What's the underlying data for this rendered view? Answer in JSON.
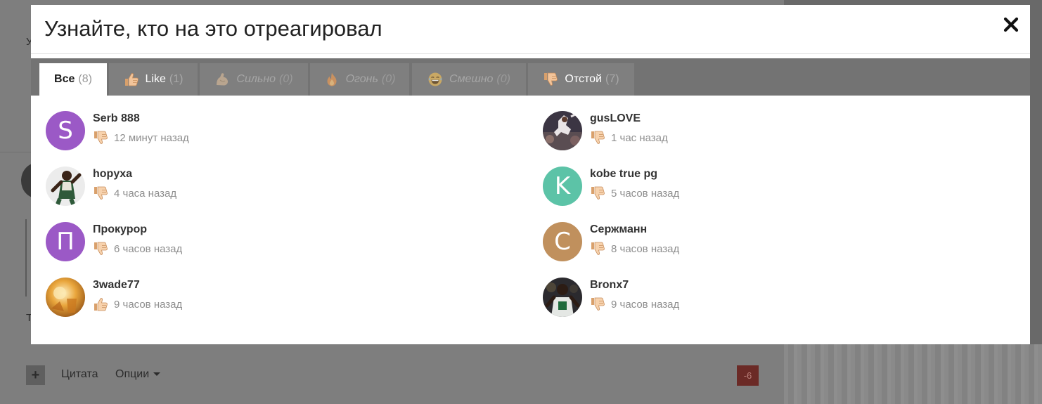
{
  "modal": {
    "title": "Узнайте, кто на это отреагировал"
  },
  "tabs": [
    {
      "label": "Все",
      "count": "(8)"
    },
    {
      "label": "Like",
      "count": "(1)"
    },
    {
      "label": "Сильно",
      "count": "(0)"
    },
    {
      "label": "Огонь",
      "count": "(0)"
    },
    {
      "label": "Смешно",
      "count": "(0)"
    },
    {
      "label": "Отстой",
      "count": "(7)"
    }
  ],
  "users": [
    {
      "name": "Serb 888",
      "time": "12 минут назад",
      "reaction": "thumbs-down-icon",
      "avatar_letter": "S",
      "avatar_color": "#9b59c6"
    },
    {
      "name": "gusLOVE",
      "time": "1 час назад",
      "reaction": "thumbs-down-icon"
    },
    {
      "name": "hopyxa",
      "time": "4 часа назад",
      "reaction": "thumbs-down-icon"
    },
    {
      "name": "kobe true pg",
      "time": "5 часов назад",
      "reaction": "thumbs-down-icon",
      "avatar_letter": "K",
      "avatar_color": "#5cc3a7"
    },
    {
      "name": "Прокурор",
      "time": "6 часов назад",
      "reaction": "thumbs-down-icon",
      "avatar_letter": "П",
      "avatar_color": "#9b59c6"
    },
    {
      "name": "Сержманн",
      "time": "8 часов назад",
      "reaction": "thumbs-down-icon",
      "avatar_letter": "C",
      "avatar_color": "#c0905d"
    },
    {
      "name": "3wade77",
      "time": "9 часов назад",
      "reaction": "thumbs-up-icon"
    },
    {
      "name": "Bronx7",
      "time": "9 часов назад",
      "reaction": "thumbs-down-icon"
    }
  ],
  "background": {
    "letter_u": "У",
    "letter_t": "Т",
    "quote_link": "Цитата",
    "options_link": "Опции",
    "score": "-6"
  }
}
